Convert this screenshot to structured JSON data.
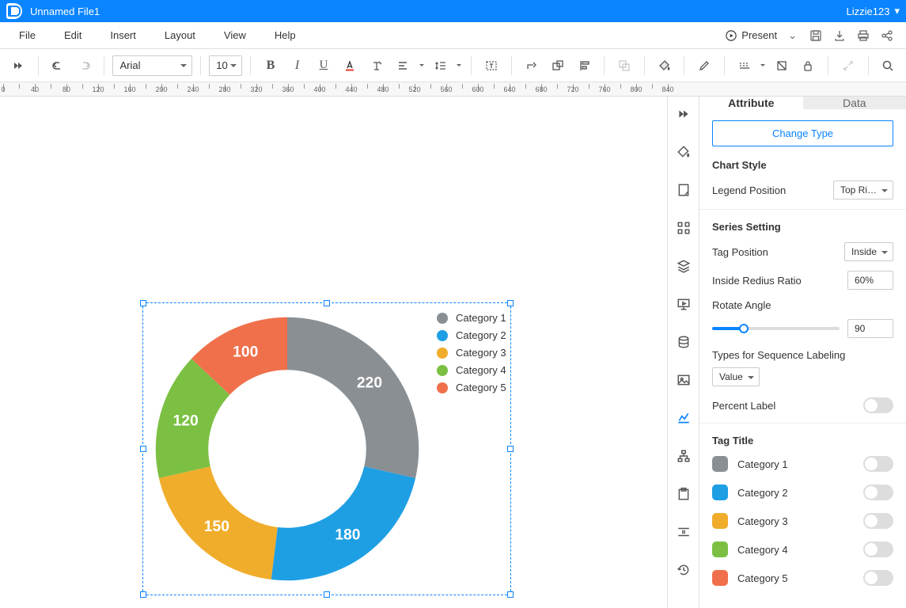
{
  "titlebar": {
    "filename": "Unnamed File1",
    "user": "Lizzie123"
  },
  "menu": {
    "file": "File",
    "edit": "Edit",
    "insert": "Insert",
    "layout": "Layout",
    "view": "View",
    "help": "Help",
    "present": "Present"
  },
  "toolbar": {
    "font": "Arial",
    "size": "10"
  },
  "props": {
    "tab_attribute": "Attribute",
    "tab_data": "Data",
    "change_type": "Change Type",
    "chart_style": "Chart Style",
    "legend_position_label": "Legend Position",
    "legend_position_value": "Top Ri…",
    "series_setting": "Series Setting",
    "tag_position_label": "Tag Position",
    "tag_position_value": "Inside",
    "inside_radius_label": "Inside Redius Ratio",
    "inside_radius_value": "60%",
    "rotate_angle_label": "Rotate Angle",
    "rotate_angle_value": "90",
    "types_label": "Types for Sequence Labeling",
    "types_value": "Value",
    "percent_label": "Percent Label",
    "tag_title": "Tag Title"
  },
  "chart_data": {
    "type": "pie",
    "inner_radius_ratio": 0.6,
    "rotate_angle": 90,
    "legend_position": "Top Right",
    "categories": [
      "Category 1",
      "Category 2",
      "Category 3",
      "Category 4",
      "Category 5"
    ],
    "values": [
      220,
      180,
      150,
      120,
      100
    ],
    "colors": [
      "#8a8f93",
      "#1e9fe4",
      "#f0ad2c",
      "#7bc043",
      "#f0704c"
    ],
    "tag_position": "Inside",
    "percent_label": false
  }
}
